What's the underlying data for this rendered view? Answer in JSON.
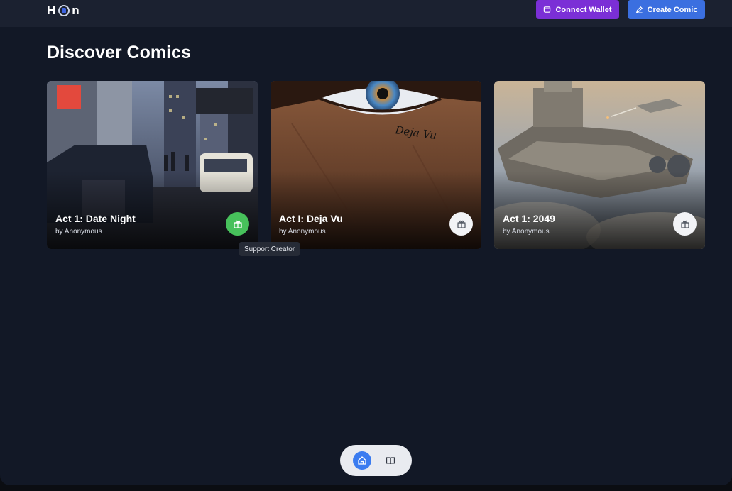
{
  "app": {
    "logo_text_left": "H",
    "logo_text_right": "n"
  },
  "header": {
    "connect_wallet_label": "Connect Wallet",
    "create_comic_label": "Create Comic"
  },
  "main": {
    "title": "Discover Comics",
    "comics": [
      {
        "title": "Act 1: Date Night",
        "author": "by Anonymous",
        "gift_state": "active"
      },
      {
        "title": "Act I: Deja Vu",
        "author": "by Anonymous",
        "gift_state": "default",
        "art_text": "Deja Vu"
      },
      {
        "title": "Act 1: 2049",
        "author": "by Anonymous",
        "gift_state": "default"
      }
    ],
    "tooltip": "Support Creator"
  },
  "icons": {
    "logo": "shield-logo-icon",
    "wallet": "wallet-icon",
    "create": "pencil-icon",
    "gift": "gift-icon",
    "home": "home-icon",
    "library": "book-open-icon"
  },
  "colors": {
    "background": "#121826",
    "header": "#1b2130",
    "wallet_button": "#7b2fd6",
    "create_button": "#3b6fe0",
    "gift_active": "#47c15b",
    "nav_active": "#3b7cf0"
  }
}
